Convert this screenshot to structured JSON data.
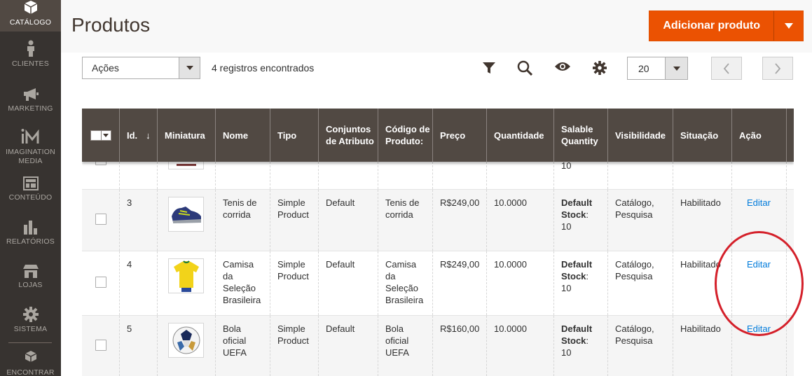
{
  "sidebar": {
    "items": [
      {
        "label": "CATÁLOGO",
        "icon": "box-icon"
      },
      {
        "label": "CLIENTES",
        "icon": "person-icon"
      },
      {
        "label": "MARKETING",
        "icon": "megaphone-icon"
      },
      {
        "label": "IMAGINATION MEDIA",
        "icon": "im-logo-icon"
      },
      {
        "label": "CONTEÚDO",
        "icon": "layout-icon"
      },
      {
        "label": "RELATÓRIOS",
        "icon": "bar-chart-icon"
      },
      {
        "label": "LOJAS",
        "icon": "store-icon"
      },
      {
        "label": "SISTEMA",
        "icon": "gear-icon"
      },
      {
        "label": "ENCONTRAR",
        "icon": "cubes-icon"
      }
    ]
  },
  "header": {
    "title": "Produtos",
    "add_button": "Adicionar produto"
  },
  "toolbar": {
    "actions": "Ações",
    "records": "4 registros encontrados",
    "per_page": "20",
    "prev": "‹",
    "next": "›"
  },
  "grid": {
    "columns": [
      "Id.",
      "Miniatura",
      "Nome",
      "Tipo",
      "Conjuntos de Atributo",
      "Código de Produto:",
      "Preço",
      "Quantidade",
      "Salable Quantity",
      "Visibilidade",
      "Situação",
      "Ação"
    ],
    "sort_arrow": "↓",
    "partial_row": {
      "salable_tail": "10"
    },
    "rows": [
      {
        "id": "3",
        "name": "Tenis de corrida",
        "type": "Simple Product",
        "attr_set": "Default",
        "sku": "Tenis de corrida",
        "price": "R$249,00",
        "qty": "10.0000",
        "salable_label": "Default Stock",
        "salable_qty": "10",
        "visibility": "Catálogo, Pesquisa",
        "status": "Habilitado",
        "action": "Editar",
        "thumb": "shoe"
      },
      {
        "id": "4",
        "name": "Camisa da Seleção Brasileira",
        "type": "Simple Product",
        "attr_set": "Default",
        "sku": "Camisa da Seleção Brasileira",
        "price": "R$249,00",
        "qty": "10.0000",
        "salable_label": "Default Stock",
        "salable_qty": "10",
        "visibility": "Catálogo, Pesquisa",
        "status": "Habilitado",
        "action": "Editar",
        "thumb": "shirt"
      },
      {
        "id": "5",
        "name": "Bola oficial UEFA",
        "type": "Simple Product",
        "attr_set": "Default",
        "sku": "Bola oficial UEFA",
        "price": "R$160,00",
        "qty": "10.0000",
        "salable_label": "Default Stock",
        "salable_qty": "10",
        "visibility": "Catálogo, Pesquisa",
        "status": "Habilitado",
        "action": "Editar",
        "thumb": "ball"
      }
    ]
  },
  "colors": {
    "accent": "#eb5202",
    "sidebar": "#373330",
    "header": "#514943",
    "link": "#007bdb",
    "annotation": "#d4202a"
  }
}
